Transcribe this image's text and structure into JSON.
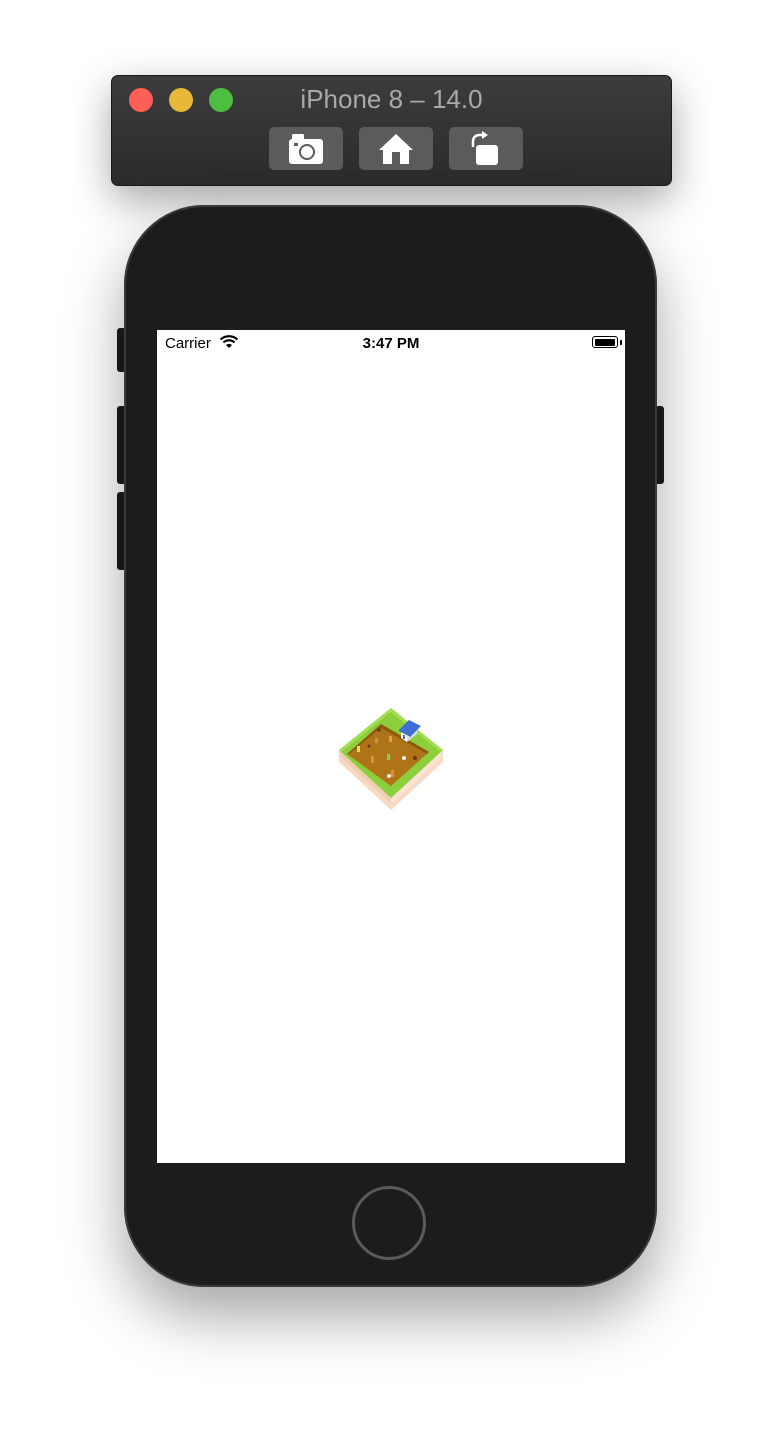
{
  "simulator": {
    "title": "iPhone 8 – 14.0",
    "buttons": [
      {
        "label": "Screenshot",
        "icon": "camera-icon"
      },
      {
        "label": "Home",
        "icon": "home-icon"
      },
      {
        "label": "Rotate",
        "icon": "rotate-icon"
      }
    ],
    "colors": {
      "close": "#fe5f57",
      "minimize": "#e6b93a",
      "maximize": "#4fbd3f"
    }
  },
  "status_bar": {
    "carrier": "Carrier",
    "time": "3:47 PM",
    "battery_level": 1.0
  },
  "screen": {
    "background": "#ffffff",
    "launch_image": "isometric-farm-icon"
  }
}
